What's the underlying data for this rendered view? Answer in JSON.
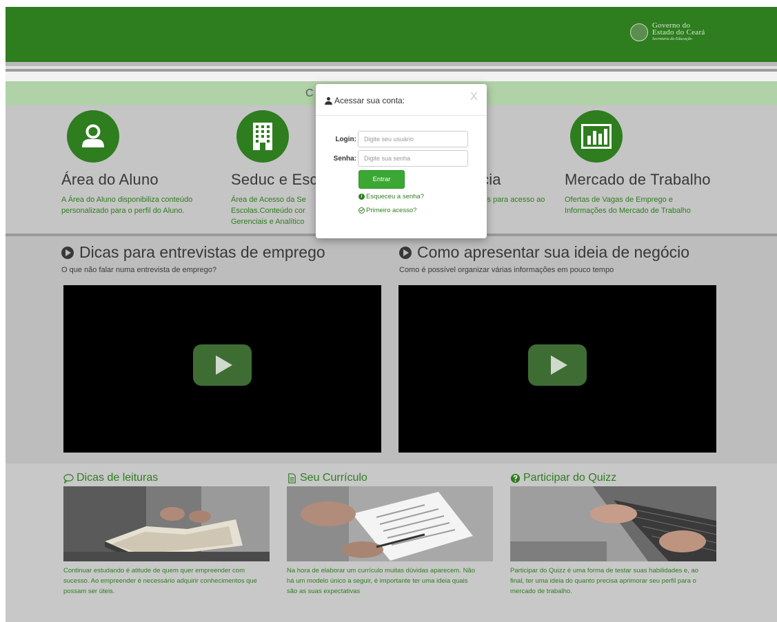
{
  "header": {
    "gov_line1": "Governo do",
    "gov_line2": "Estado do Ceará",
    "gov_line3": "Secretaria da Educação"
  },
  "banner_visible_letter": "C",
  "features": [
    {
      "icon": "user-icon",
      "title": "Área do Aluno",
      "desc_lines": [
        "A Área do Aluno disponibiliza conteúdo",
        "personalizado para o perfil do Aluno."
      ]
    },
    {
      "icon": "building-icon",
      "title": "Seduc e Esc",
      "desc_lines": [
        "Área de Acesso da Se",
        "Escolas.Conteúdo cor",
        "Gerenciais e Analítico"
      ]
    },
    {
      "icon": "",
      "title": "cia",
      "desc_lines": [
        "eis para acesso ao"
      ]
    },
    {
      "icon": "bar-chart-icon",
      "title": "Mercado de Trabalho",
      "desc_lines": [
        "Ofertas de Vagas de Emprego e",
        "Informações do Mercado de Trabalho"
      ]
    }
  ],
  "videos": [
    {
      "icon": "play-circle-icon",
      "title": "Dicas para entrevistas de emprego",
      "subtitle": "O que não falar numa entrevista de emprego?"
    },
    {
      "icon": "play-circle-icon",
      "title": "Como apresentar sua ideia de negócio",
      "subtitle": "Como é possível organizar várias informações em pouco tempo"
    }
  ],
  "bottom": [
    {
      "icon": "speech-bubble-icon",
      "title": "Dicas de leituras",
      "desc_lines": [
        "Continuar estudando é atitude de quem quer empreender com",
        "sucesso. Ao empreender é necessário adquirir conhecimentos que",
        "possam ser úteis."
      ]
    },
    {
      "icon": "document-icon",
      "title": "Seu Currículo",
      "desc_lines": [
        "Na hora de elaborar um currículo muitas dúvidas aparecem. Não",
        "há um modelo único a seguir, é importante ter uma ideia quais",
        "são as suas expectativas"
      ]
    },
    {
      "icon": "question-circle-icon",
      "title": "Participar do Quizz",
      "desc_lines": [
        "Participar do Quizz é uma forma de testar suas habilidades e, ao",
        "final, ter uma ideia do quanto precisa aprimorar seu perfil para o",
        "mercado de trabalho."
      ]
    }
  ],
  "modal": {
    "title": "Acessar sua conta:",
    "close_label": "X",
    "login_label": "Login:",
    "login_placeholder": "Digite seu usuário",
    "login_value": "",
    "password_label": "Senha:",
    "password_placeholder": "Digite sua senha",
    "password_value": "",
    "submit_label": "Entrar",
    "forgot_label": "Esqueceu a senha?",
    "first_access_label": "Primeiro acesso?"
  },
  "colors": {
    "brand_green": "#2e7d1f",
    "button_green": "#3ba834",
    "overlay_gray": "#c5c5c5"
  }
}
